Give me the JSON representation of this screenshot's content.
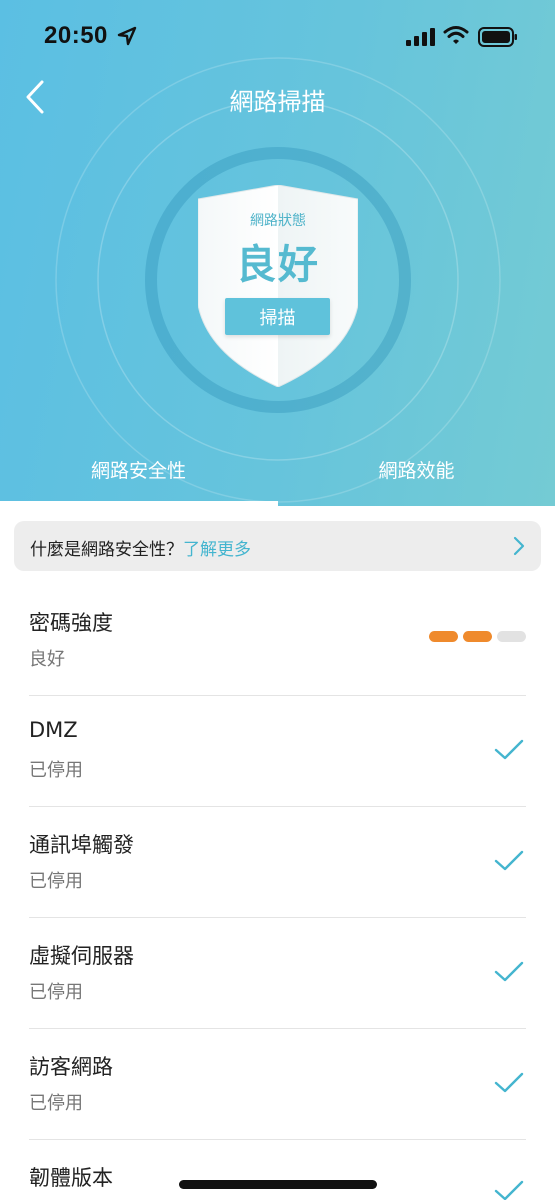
{
  "status_bar": {
    "time": "20:50",
    "icons": [
      "location-arrow-icon",
      "signal-bars-icon",
      "wifi-icon",
      "battery-icon"
    ]
  },
  "header": {
    "title": "網路掃描",
    "back_icon": "chevron-left-icon"
  },
  "shield": {
    "label": "網路狀態",
    "status": "良好",
    "scan_button": "掃描"
  },
  "tabs": [
    {
      "label": "網路安全性",
      "active": true
    },
    {
      "label": "網路效能",
      "active": false
    }
  ],
  "info_bar": {
    "question": "什麼是網路安全性？",
    "link": "了解更多",
    "icon": "chevron-right-icon"
  },
  "items": [
    {
      "title": "密碼強度",
      "status": "良好",
      "indicator": "strength-bar",
      "strength_level": 2,
      "strength_max": 3
    },
    {
      "title": "DMZ",
      "status": "已停用",
      "indicator": "check-icon"
    },
    {
      "title": "通訊埠觸發",
      "status": "已停用",
      "indicator": "check-icon"
    },
    {
      "title": "虛擬伺服器",
      "status": "已停用",
      "indicator": "check-icon"
    },
    {
      "title": "訪客網路",
      "status": "已停用",
      "indicator": "check-icon"
    },
    {
      "title": "韌體版本",
      "status": "",
      "indicator": "check-icon"
    }
  ],
  "colors": {
    "accent": "#5fc2db",
    "link": "#44b5cf",
    "strength_filled": "#ef8a2c",
    "strength_empty": "#e2e2e2",
    "hero_gradient": [
      "#5bbfe3",
      "#74cbd4"
    ]
  }
}
